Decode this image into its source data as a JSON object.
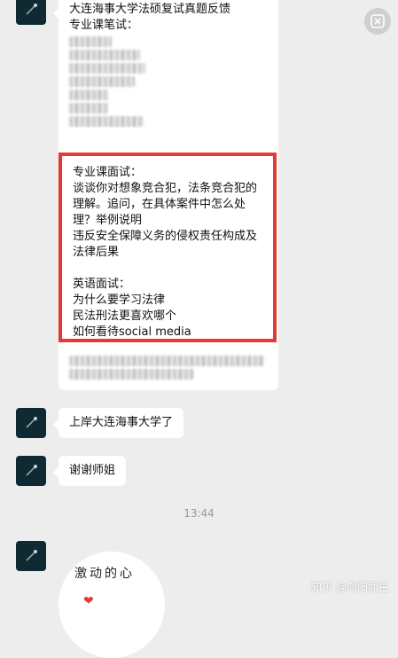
{
  "close_button": {
    "icon": "close-icon"
  },
  "first_message": {
    "title": "大连海事大学法硕复试真题反馈",
    "subtitle": "专业课笔试：",
    "blurred_line_count": 7
  },
  "highlight": {
    "lines": [
      "专业课面试：",
      "谈谈你对想象竞合犯，法条竞合犯的",
      "理解。追问，在具体案件中怎么处",
      "理？举例说明",
      "违反安全保障义务的侵权责任构成及",
      "法律后果",
      "",
      "英语面试：",
      "为什么要学习法律",
      "民法刑法更喜欢哪个",
      "如何看待social media"
    ]
  },
  "messages": [
    {
      "text": "上岸大连海事大学了"
    },
    {
      "text": "谢谢师姐"
    }
  ],
  "timestamp": "13:44",
  "sticker": {
    "text": "激动的心"
  },
  "watermark": "知乎 @向阳而生",
  "colors": {
    "highlight_border": "#e53935",
    "background": "#ededed",
    "avatar": "#0f2a33"
  }
}
